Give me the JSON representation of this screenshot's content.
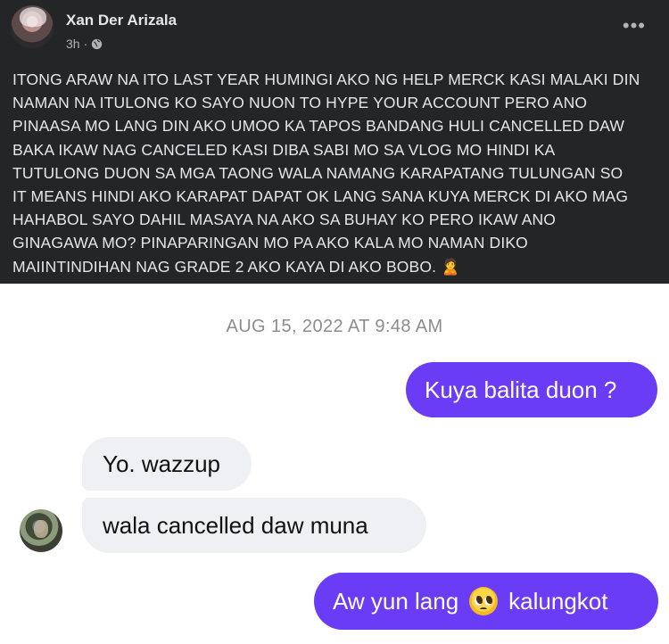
{
  "post": {
    "author": "Xan Der Arizala",
    "time": "3h",
    "time_separator": "·",
    "audience_icon": "globe-icon",
    "more_label": "•••",
    "text": "ITONG ARAW NA ITO LAST YEAR HUMINGI AKO NG HELP MERCK KASI MALAKI DIN\nNAMAN NA ITULONG KO SAYO NUON TO HYPE YOUR ACCOUNT PERO ANO\nPINAASA MO LANG DIN AKO UMOO KA TAPOS BANDANG HULI CANCELLED DAW\nBAKA IKAW NAG CANCELED KASI DIBA SABI MO SA VLOG MO HINDI KA\nTUTULONG DUON SA MGA TAONG WALA NAMANG KARAPATANG TULUNGAN SO\nIT MEANS HINDI AKO KARAPAT DAPAT OK LANG SANA KUYA MERCK DI AKO MAG\nHAHABOL SAYO DAHIL MASAYA NA AKO SA BUHAY KO PERO IKAW ANO\nGINAGAWA MO? PINAPARINGAN MO PA AKO KALA MO NAMAN DIKO\nMAIINTINDIHAN NAG GRADE 2 AKO KAYA DI AKO BOBO. 🙎"
  },
  "chat": {
    "timestamp": "AUG 15, 2022 AT 9:48 AM",
    "messages": [
      {
        "direction": "outgoing",
        "text": "Kuya balita duon ?"
      },
      {
        "direction": "incoming",
        "text": "Yo. wazzup"
      },
      {
        "direction": "incoming",
        "text": "wala cancelled daw muna"
      },
      {
        "direction": "outgoing",
        "text_before": "Aw yun lang",
        "emoji": "pleading-face-emoji",
        "text_after": "kalungkot"
      }
    ]
  },
  "colors": {
    "post_background": "#242526",
    "post_text": "#e4e6eb",
    "outgoing_bubble": "#6a3cf6",
    "incoming_bubble": "#eef0f4",
    "timestamp_text": "#8a8d91"
  }
}
